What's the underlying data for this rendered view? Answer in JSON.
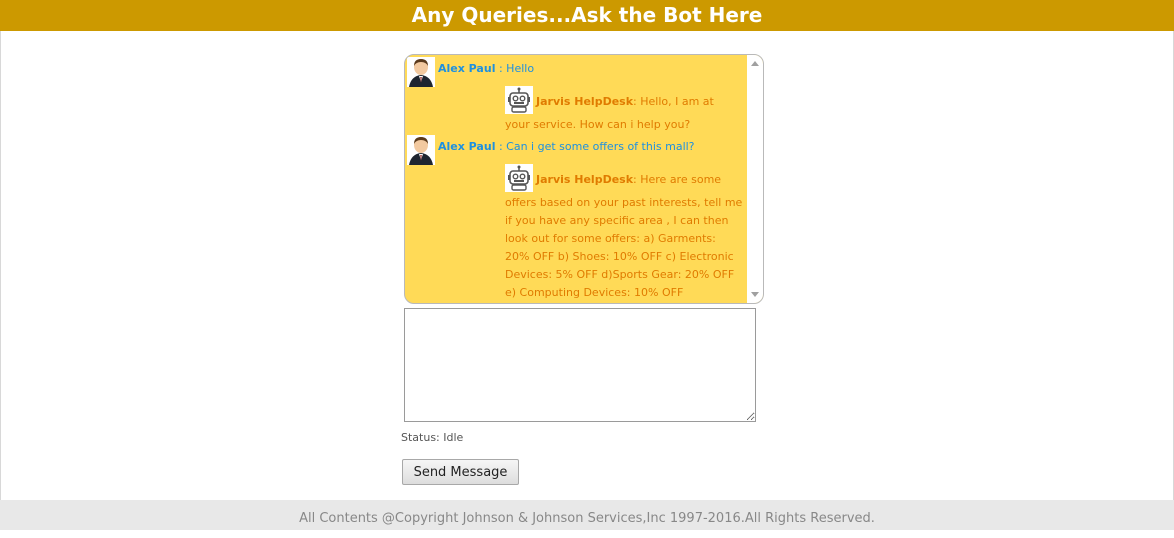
{
  "header": {
    "title": "Any Queries...Ask the Bot Here"
  },
  "chat": {
    "messages": [
      {
        "sender": "Alex Paul",
        "separator": " : ",
        "text": "Hello",
        "role": "user",
        "icon": "user-avatar-icon"
      },
      {
        "sender": "Jarvis HelpDesk",
        "separator": ": ",
        "text": "Hello, I am at your service. How can i help you?",
        "role": "bot",
        "icon": "robot-icon"
      },
      {
        "sender": "Alex Paul",
        "separator": " : ",
        "text": "Can i get some offers of this mall?",
        "role": "user",
        "icon": "user-avatar-icon"
      },
      {
        "sender": "Jarvis HelpDesk",
        "separator": ": ",
        "text": "Here are some offers based on your past interests, tell me if you have any specific area , I can then look out for some offers: a) Garments: 20% OFF b) Shoes: 10% OFF c) Electronic Devices: 5% OFF d)Sports Gear: 20% OFF e) Computing Devices: 10% OFF",
        "role": "bot",
        "icon": "robot-icon"
      }
    ]
  },
  "input": {
    "value": "",
    "placeholder": ""
  },
  "status": {
    "label": "Status: Idle"
  },
  "send_button": {
    "label": "Send Message"
  },
  "footer": {
    "text": "All Contents @Copyright Johnson & Johnson Services,Inc 1997-2016.All Rights Reserved."
  },
  "colors": {
    "header_bg": "#cc9900",
    "chat_bg": "#ffda57",
    "user_text": "#1e90e0",
    "bot_text": "#e07b00"
  }
}
